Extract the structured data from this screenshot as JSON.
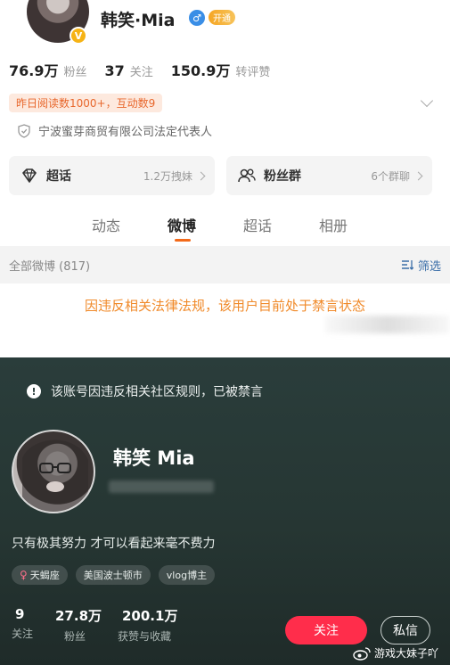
{
  "weibo": {
    "profile": {
      "name": "韩笑·Mia",
      "verified_badge": "V",
      "gender_symbol": "♂",
      "vip_label": "开通"
    },
    "stats": [
      {
        "value": "76.9万",
        "label": "粉丝"
      },
      {
        "value": "37",
        "label": "关注"
      },
      {
        "value": "150.9万",
        "label": "转评赞"
      }
    ],
    "read_badge": "昨日阅读数1000+，互动数9",
    "company": "宁波蜜芽商贸有限公司法定代表人",
    "cards": [
      {
        "icon": "diamond-icon",
        "title": "超话",
        "sub": "1.2万拽妹"
      },
      {
        "icon": "group-icon",
        "title": "粉丝群",
        "sub": "6个群聊"
      }
    ],
    "tabs": [
      "动态",
      "微博",
      "超话",
      "相册"
    ],
    "active_tab": "微博",
    "all_posts": "全部微博 (817)",
    "filter_label": "筛选",
    "banned_message": "因违反相关法律法规，该用户目前处于禁言状态",
    "accent_color": "#f36a1a"
  },
  "xhs": {
    "notice": "该账号因违反相关社区规则，已被禁言",
    "name": "韩笑 Mia",
    "bio": "只有极其努力 才可以看起来毫不费力",
    "tags": [
      {
        "symbol": "♀",
        "label": "天蝎座"
      },
      {
        "symbol": "",
        "label": "美国波士顿市"
      },
      {
        "symbol": "",
        "label": "vlog博主"
      }
    ],
    "stats": [
      {
        "value": "9",
        "label": "关注"
      },
      {
        "value": "27.8万",
        "label": "粉丝"
      },
      {
        "value": "200.1万",
        "label": "获赞与收藏"
      }
    ],
    "follow_label": "关注",
    "dm_label": "私信",
    "watermark": "游戏大妹子吖",
    "accent_color": "#ff2d4b"
  }
}
